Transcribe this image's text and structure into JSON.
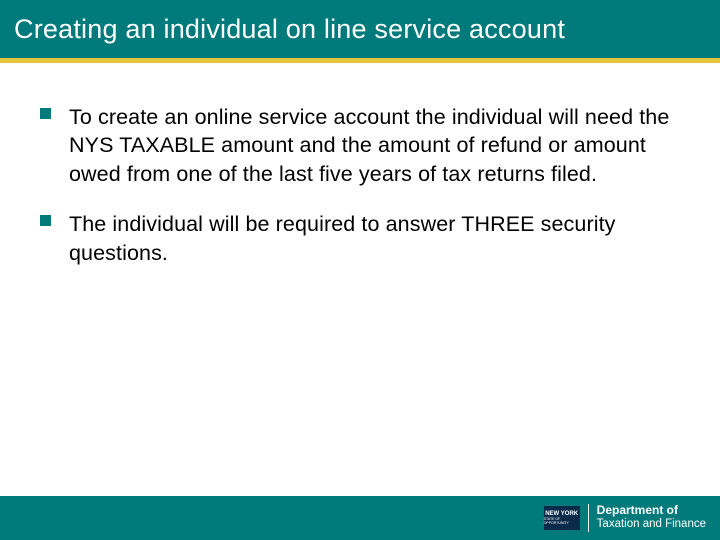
{
  "header": {
    "title": "Creating an individual on line service account"
  },
  "content": {
    "bullets": [
      "To create an online service account the individual will need the NYS TAXABLE amount and the amount of refund or amount owed from one of the last five years of tax returns filed.",
      "The individual will be required to answer THREE security questions."
    ]
  },
  "footer": {
    "seal_top": "NEW YORK",
    "seal_bottom": "STATE OF OPPORTUNITY",
    "dept_line1": "Department of",
    "dept_line2": "Taxation and Finance"
  },
  "colors": {
    "teal": "#007a7a",
    "gold": "#e6c43c",
    "navy": "#0a2a4a"
  }
}
